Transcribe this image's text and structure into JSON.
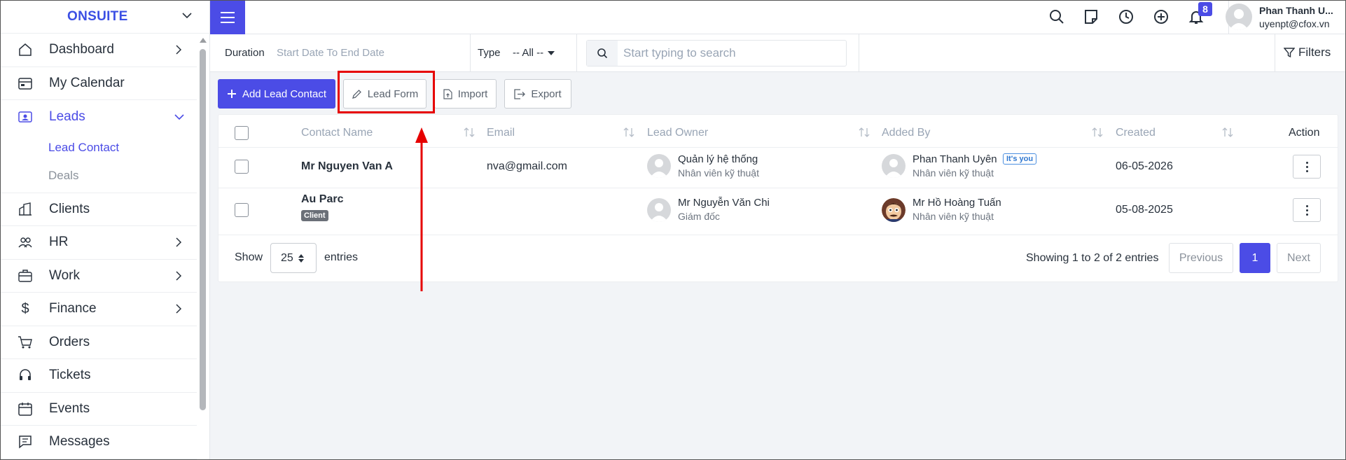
{
  "sidebar": {
    "brand": "ONSUITE",
    "items": [
      {
        "label": "Dashboard",
        "icon": "home-icon"
      },
      {
        "label": "My Calendar",
        "icon": "calendar-icon"
      },
      {
        "label": "Leads",
        "icon": "contact-card-icon"
      },
      {
        "label": "Clients",
        "icon": "building-icon"
      },
      {
        "label": "HR",
        "icon": "people-icon"
      },
      {
        "label": "Work",
        "icon": "briefcase-icon"
      },
      {
        "label": "Finance",
        "icon": "dollar-icon"
      },
      {
        "label": "Orders",
        "icon": "cart-icon"
      },
      {
        "label": "Tickets",
        "icon": "headset-icon"
      },
      {
        "label": "Events",
        "icon": "event-calendar-icon"
      },
      {
        "label": "Messages",
        "icon": "message-icon"
      }
    ],
    "leads_sub": [
      "Lead Contact",
      "Deals"
    ]
  },
  "topbar": {
    "notification_count": "8",
    "user_name": "Phan Thanh U...",
    "user_email": "uyenpt@cfox.vn"
  },
  "filters": {
    "duration_label": "Duration",
    "duration_placeholder": "Start Date To End Date",
    "type_label": "Type",
    "type_value": "-- All --",
    "search_placeholder": "Start typing to search",
    "filters_label": "Filters"
  },
  "actions": {
    "add": "Add Lead Contact",
    "lead_form": "Lead Form",
    "import": "Import",
    "export": "Export"
  },
  "table": {
    "columns": [
      "Contact Name",
      "Email",
      "Lead Owner",
      "Added By",
      "Created",
      "Action"
    ],
    "rows": [
      {
        "name": "Mr Nguyen Van A",
        "email": "nva@gmail.com",
        "owner_name": "Quản lý hệ thống",
        "owner_role": "Nhân viên kỹ thuật",
        "added_name": "Phan Thanh Uyên",
        "added_badge": "It's you",
        "added_role": "Nhân viên kỹ thuật",
        "created": "06-05-2026"
      },
      {
        "name": "Au Parc",
        "name_badge": "Client",
        "email": "",
        "owner_name": "Mr Nguyễn Văn Chi",
        "owner_role": "Giám đốc",
        "added_name": "Mr Hồ Hoàng Tuấn",
        "added_role": "Nhân viên kỹ thuật",
        "created": "05-08-2025"
      }
    ]
  },
  "pagination": {
    "show_label": "Show",
    "entries_value": "25",
    "entries_label": "entries",
    "info": "Showing 1 to 2 of 2 entries",
    "previous": "Previous",
    "current_page": "1",
    "next": "Next"
  },
  "colors": {
    "accent": "#4b4ce6",
    "highlight": "#e60000"
  }
}
